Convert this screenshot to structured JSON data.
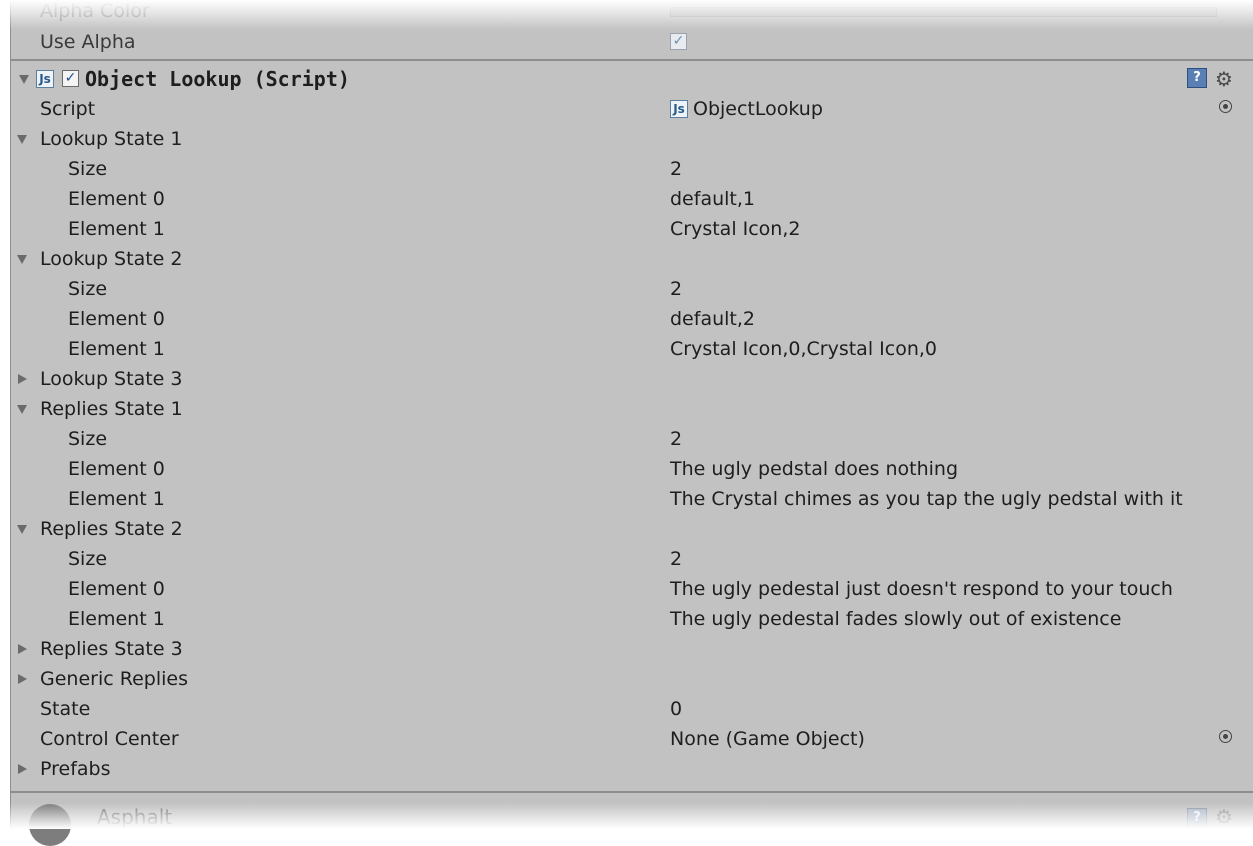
{
  "top": {
    "alpha_color_label": "Alpha Color",
    "use_alpha_label": "Use Alpha",
    "use_alpha_checked": true
  },
  "component": {
    "title": "Object Lookup (Script)",
    "enabled": true,
    "js_icon_text": "Js",
    "help_icon_text": "?",
    "gear_icon_text": "⚙"
  },
  "rows": [
    {
      "label": "Script",
      "value": "ObjectLookup",
      "indent": 0,
      "foldout": "none",
      "value_icon": "js-icon",
      "object_picker": true
    },
    {
      "label": "Lookup State 1",
      "value": "",
      "indent": 0,
      "foldout": "open"
    },
    {
      "label": "Size",
      "value": "2",
      "indent": 1,
      "foldout": "none"
    },
    {
      "label": "Element 0",
      "value": "default,1",
      "indent": 1,
      "foldout": "none"
    },
    {
      "label": "Element 1",
      "value": "Crystal Icon,2",
      "indent": 1,
      "foldout": "none"
    },
    {
      "label": "Lookup State 2",
      "value": "",
      "indent": 0,
      "foldout": "open"
    },
    {
      "label": "Size",
      "value": "2",
      "indent": 1,
      "foldout": "none"
    },
    {
      "label": "Element 0",
      "value": "default,2",
      "indent": 1,
      "foldout": "none"
    },
    {
      "label": "Element 1",
      "value": "Crystal Icon,0,Crystal Icon,0",
      "indent": 1,
      "foldout": "none"
    },
    {
      "label": "Lookup State 3",
      "value": "",
      "indent": 0,
      "foldout": "closed"
    },
    {
      "label": "Replies State 1",
      "value": "",
      "indent": 0,
      "foldout": "open"
    },
    {
      "label": "Size",
      "value": "2",
      "indent": 1,
      "foldout": "none"
    },
    {
      "label": "Element 0",
      "value": "The ugly pedstal does nothing",
      "indent": 1,
      "foldout": "none"
    },
    {
      "label": "Element 1",
      "value": "The Crystal chimes as you tap the ugly pedstal with it",
      "indent": 1,
      "foldout": "none"
    },
    {
      "label": "Replies State 2",
      "value": "",
      "indent": 0,
      "foldout": "open"
    },
    {
      "label": "Size",
      "value": "2",
      "indent": 1,
      "foldout": "none"
    },
    {
      "label": "Element 0",
      "value": "The ugly pedestal just doesn't respond to your touch",
      "indent": 1,
      "foldout": "none"
    },
    {
      "label": "Element 1",
      "value": "The ugly pedestal fades slowly out of existence",
      "indent": 1,
      "foldout": "none"
    },
    {
      "label": "Replies State 3",
      "value": "",
      "indent": 0,
      "foldout": "closed"
    },
    {
      "label": "Generic Replies",
      "value": "",
      "indent": 0,
      "foldout": "closed"
    },
    {
      "label": "State",
      "value": "0",
      "indent": 0,
      "foldout": "none"
    },
    {
      "label": "Control Center",
      "value": "None (Game Object)",
      "indent": 0,
      "foldout": "none",
      "object_picker": true
    },
    {
      "label": "Prefabs",
      "value": "",
      "indent": 0,
      "foldout": "closed"
    }
  ],
  "next_component": {
    "title": "Asphalt"
  },
  "colors": {
    "panel_bg": "#c2c2c2",
    "text": "#1e1e1e",
    "separator": "#8d8d8d"
  }
}
